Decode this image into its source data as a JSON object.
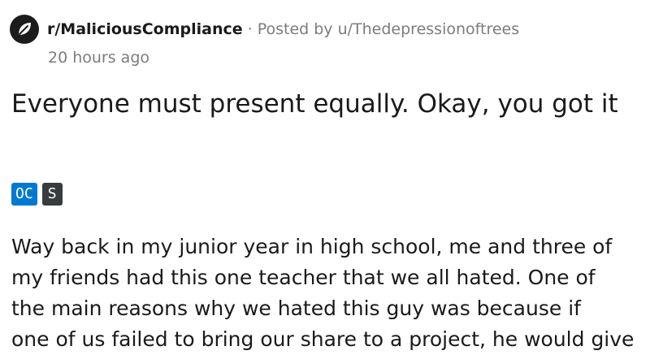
{
  "header": {
    "subreddit": "r/MaliciousCompliance",
    "separator": "·",
    "posted_by": "Posted by u/Thedepressionoftrees",
    "time": "20 hours ago",
    "subreddit_icon": "subreddit-icon"
  },
  "post": {
    "title": "Everyone must present equally. Okay, you got it",
    "flairs": [
      "OC",
      "S"
    ],
    "body_lines": [
      "Way back in my junior year in high school, me and three of",
      "my friends had this one teacher that we all hated. One of",
      "the main reasons why we hated this guy was because if",
      "one of us failed to bring our share to a project, he would give"
    ]
  },
  "colors": {
    "oc_flair": "#0079d3",
    "s_flair": "#373c3f",
    "meta_text": "#7c7c7c",
    "text": "#1a1a1b"
  }
}
